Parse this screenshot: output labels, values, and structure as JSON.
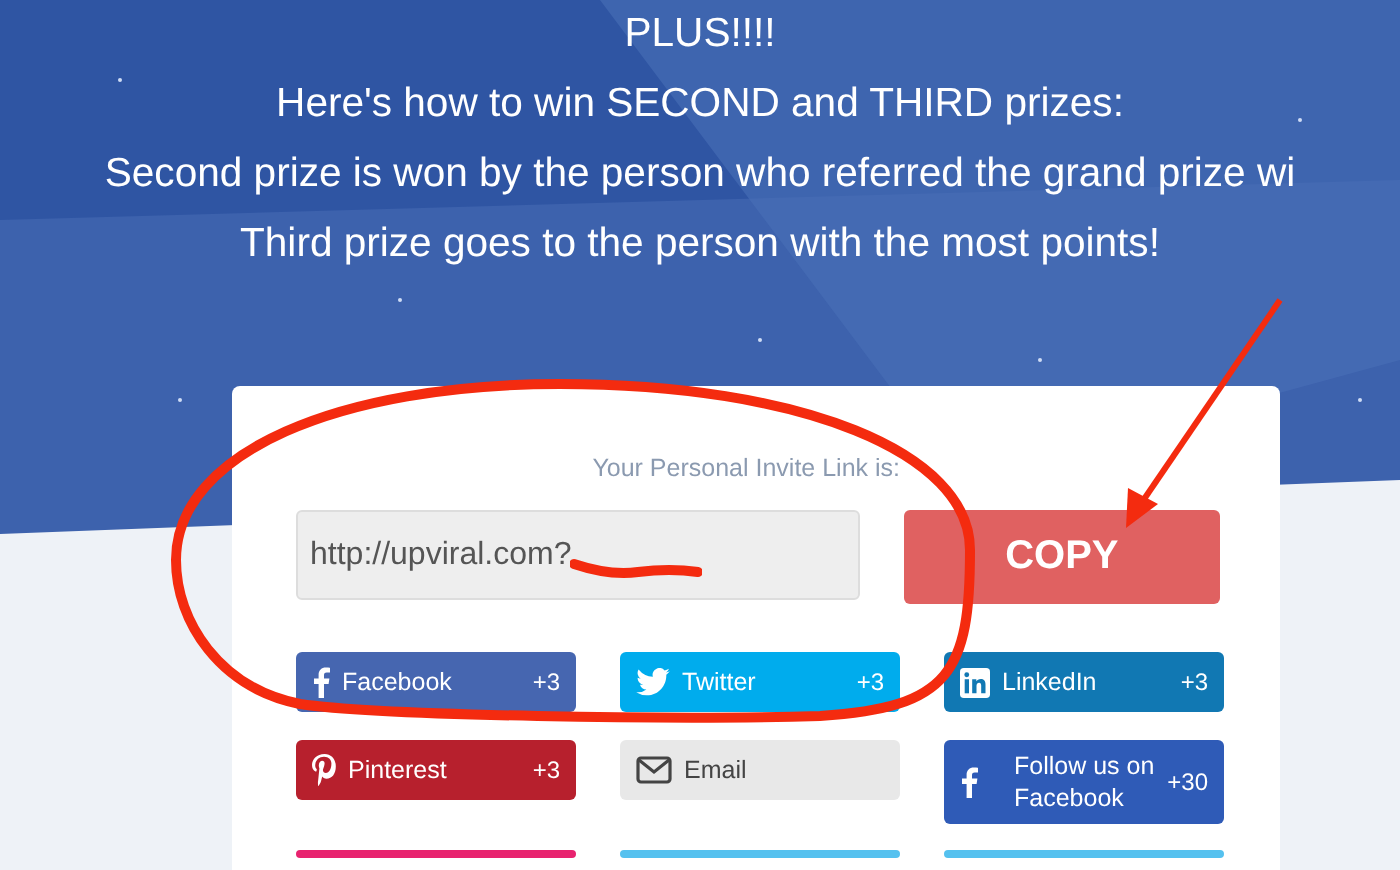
{
  "headline": [
    "PLUS!!!!",
    "Here's how to win SECOND and THIRD prizes:",
    "Second prize is won by the person who referred the grand prize wi",
    "Third prize goes to the person with the most points!"
  ],
  "invite": {
    "label": "Your Personal Invite Link is:",
    "value": "http://upviral.com?",
    "button": "COPY"
  },
  "share_buttons": [
    {
      "kind": "facebook",
      "label": "Facebook",
      "points": "+3",
      "color": "#4666b0"
    },
    {
      "kind": "twitter",
      "label": "Twitter",
      "points": "+3",
      "color": "#00aced"
    },
    {
      "kind": "linkedin",
      "label": "LinkedIn",
      "points": "+3",
      "color": "#1178b3"
    },
    {
      "kind": "pinterest",
      "label": "Pinterest",
      "points": "+3",
      "color": "#b7202d"
    },
    {
      "kind": "email",
      "label": "Email",
      "color": "#e8e8e8"
    },
    {
      "kind": "facebook",
      "label": "Follow us on Facebook",
      "points": "+30",
      "color": "#2f5bb7"
    },
    {
      "kind": "cut",
      "color": "#e8236f"
    },
    {
      "kind": "cut",
      "color": "#55c1ef"
    },
    {
      "kind": "cut",
      "color": "#55c1ef"
    }
  ]
}
